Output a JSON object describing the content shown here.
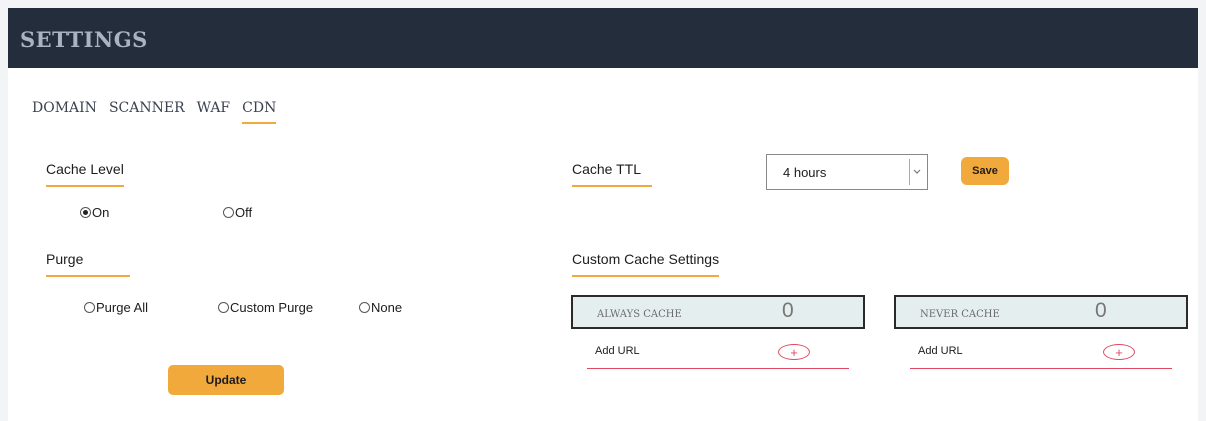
{
  "header": {
    "title": "SETTINGS"
  },
  "tabs": [
    {
      "label": "DOMAIN"
    },
    {
      "label": "SCANNER"
    },
    {
      "label": "WAF"
    },
    {
      "label": "CDN",
      "active": true
    }
  ],
  "cache_level": {
    "label": "Cache Level",
    "options": [
      {
        "label": "On",
        "checked": true
      },
      {
        "label": "Off",
        "checked": false
      }
    ]
  },
  "purge": {
    "label": "Purge",
    "options": [
      {
        "label": "Purge All",
        "checked": false
      },
      {
        "label": "Custom Purge",
        "checked": false
      },
      {
        "label": "None",
        "checked": false
      }
    ],
    "update_label": "Update"
  },
  "cache_ttl": {
    "label": "Cache TTL",
    "selected": "4 hours",
    "save_label": "Save"
  },
  "custom_cache": {
    "label": "Custom Cache Settings",
    "always": {
      "label": "ALWAYS CACHE",
      "count": "0",
      "add_label": "Add URL",
      "add_icon": "+"
    },
    "never": {
      "label": "NEVER CACHE",
      "count": "0",
      "add_label": "Add URL",
      "add_icon": "+"
    }
  },
  "colors": {
    "header_bg": "#232d3b",
    "accent": "#f2a93b",
    "add_red": "#e04a60"
  }
}
